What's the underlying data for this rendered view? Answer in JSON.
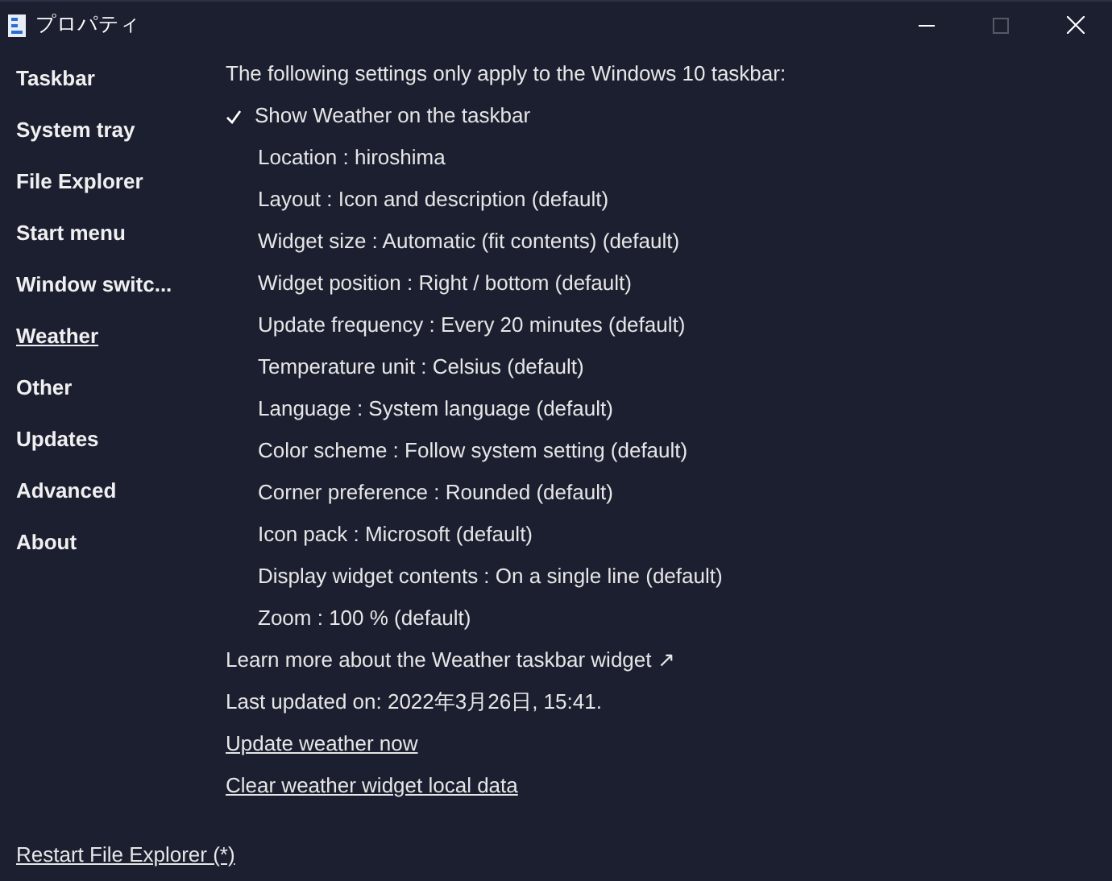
{
  "window": {
    "title": "プロパティ",
    "maximize_disabled": true
  },
  "sidebar": {
    "items": [
      {
        "label": "Taskbar",
        "selected": false
      },
      {
        "label": "System tray",
        "selected": false
      },
      {
        "label": "File Explorer",
        "selected": false
      },
      {
        "label": "Start menu",
        "selected": false
      },
      {
        "label": "Window switc...",
        "selected": false
      },
      {
        "label": "Weather",
        "selected": true
      },
      {
        "label": "Other",
        "selected": false
      },
      {
        "label": "Updates",
        "selected": false
      },
      {
        "label": "Advanced",
        "selected": false
      },
      {
        "label": "About",
        "selected": false
      }
    ]
  },
  "content": {
    "note": "The following settings only apply to the Windows 10 taskbar:",
    "toggle": {
      "label": "Show Weather on the taskbar",
      "checked": true
    },
    "settings": [
      "Location : hiroshima",
      "Layout : Icon and description (default)",
      "Widget size : Automatic (fit contents) (default)",
      "Widget position : Right / bottom (default)",
      "Update frequency : Every 20 minutes (default)",
      "Temperature unit : Celsius (default)",
      "Language : System language (default)",
      "Color scheme : Follow system setting (default)",
      "Corner preference : Rounded (default)",
      "Icon pack : Microsoft (default)",
      "Display widget contents : On a single line (default)",
      "Zoom : 100 % (default)"
    ],
    "learn_more": "Learn more about the Weather taskbar widget ↗",
    "last_updated": "Last updated on: 2022年3月26日, 15:41.",
    "actions": [
      "Update weather now",
      "Clear weather widget local data"
    ]
  },
  "footer": {
    "link": "Restart File Explorer (*)"
  }
}
